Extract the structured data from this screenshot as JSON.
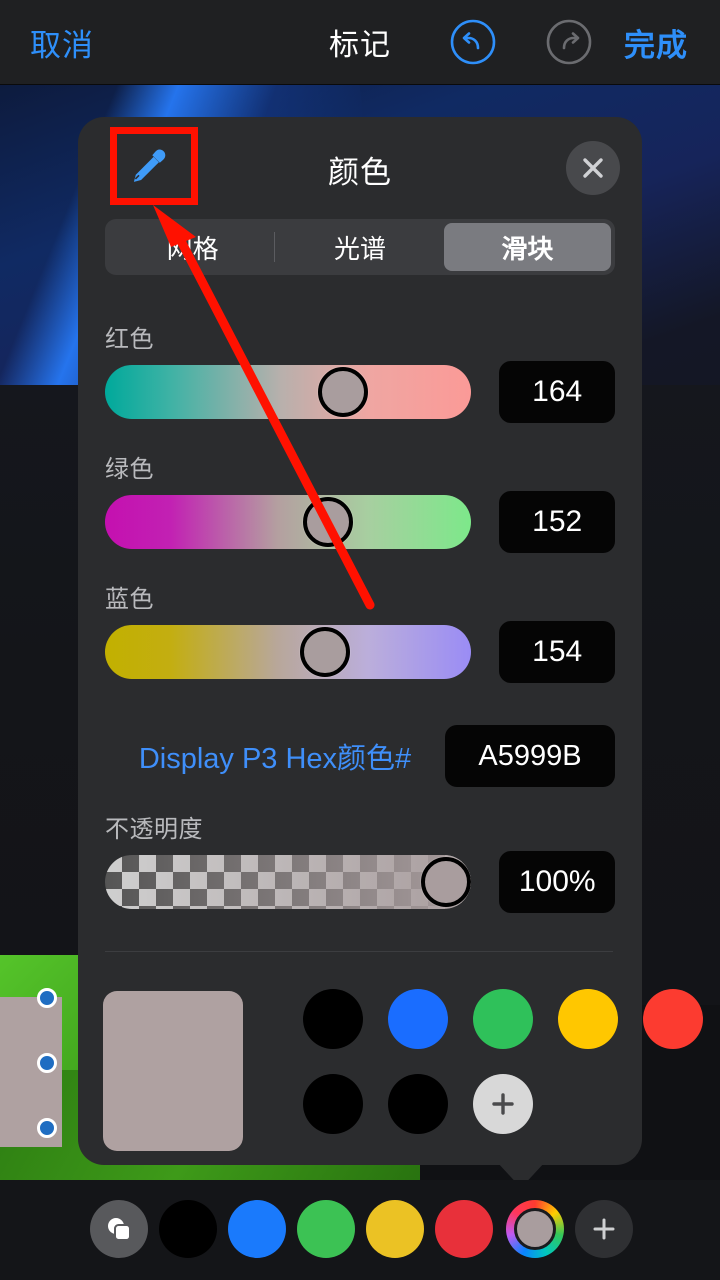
{
  "topbar": {
    "cancel_label": "取消",
    "title": "标记",
    "done_label": "完成",
    "undo_icon": "undo-arrow-icon",
    "redo_icon": "redo-arrow-icon",
    "accent_color": "#2e8ffa",
    "undo_enabled_color": "#2e8ffa",
    "redo_disabled_color": "#6b6c70"
  },
  "color_panel": {
    "title": "颜色",
    "eyedropper_icon": "eyedropper-icon",
    "close_icon": "close-x-icon",
    "tabs": [
      {
        "label": "网格",
        "selected": false
      },
      {
        "label": "光谱",
        "selected": false
      },
      {
        "label": "滑块",
        "selected": true
      }
    ],
    "sliders": [
      {
        "name": "red",
        "label": "红色",
        "value": "164"
      },
      {
        "name": "green",
        "label": "绿色",
        "value": "152"
      },
      {
        "name": "blue",
        "label": "蓝色",
        "value": "154"
      }
    ],
    "hex": {
      "label": "Display P3 Hex颜色#",
      "value": "A5999B",
      "label_color": "#3f8ffa"
    },
    "opacity": {
      "label": "不透明度",
      "value": "100%"
    },
    "preview_color": "#afa1a1",
    "swatches_row1": [
      {
        "name": "swatch-black",
        "color": "#000000"
      },
      {
        "name": "swatch-blue",
        "color": "#1a6dff"
      },
      {
        "name": "swatch-green",
        "color": "#2fc15a"
      },
      {
        "name": "swatch-yellow",
        "color": "#ffc700"
      },
      {
        "name": "swatch-red",
        "color": "#fc3b30"
      }
    ],
    "swatches_row2": [
      {
        "name": "swatch-black-2",
        "color": "#000000"
      },
      {
        "name": "swatch-black-3",
        "color": "#000000"
      }
    ],
    "add_swatch_label": "+"
  },
  "bottom_toolbar": {
    "layers_icon": "layers-copy-icon",
    "swatches": [
      {
        "name": "toolbar-swatch-black",
        "color": "#000000"
      },
      {
        "name": "toolbar-swatch-blue",
        "color": "#1a7afc"
      },
      {
        "name": "toolbar-swatch-green",
        "color": "#3cc254"
      },
      {
        "name": "toolbar-swatch-yellow",
        "color": "#ebc224"
      },
      {
        "name": "toolbar-swatch-red",
        "color": "#e8303a"
      }
    ],
    "picker_icon": "rainbow-color-picker-icon",
    "picker_current_color": "#a99d9e",
    "add_label": "+"
  },
  "annotation": {
    "highlight_color": "#ff1100",
    "target": "eyedropper-icon"
  }
}
